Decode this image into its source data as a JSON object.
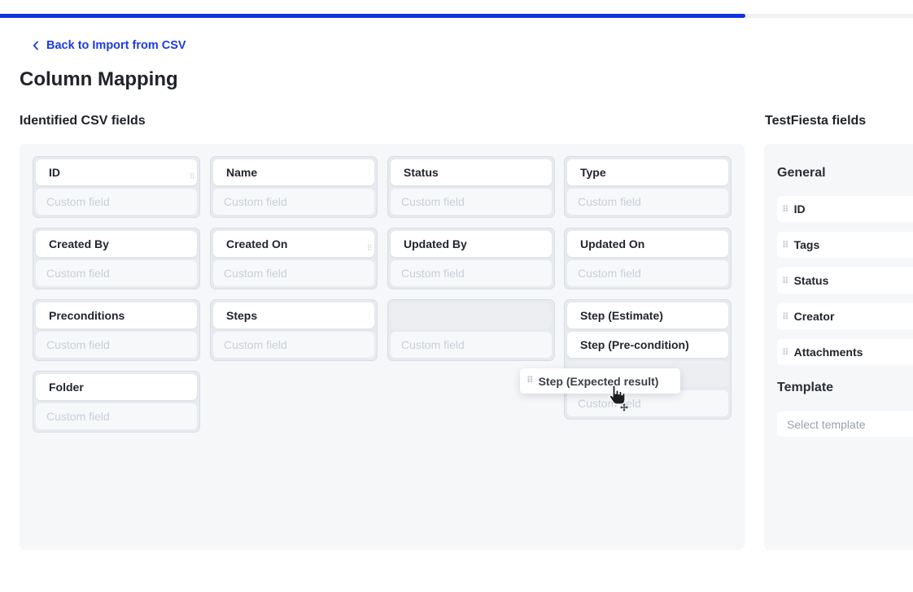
{
  "progress": {
    "percent": 81.6,
    "color": "#1233e0"
  },
  "back_link": {
    "label": "Back to Import from CSV"
  },
  "page_title": "Column Mapping",
  "csv_section": {
    "title": "Identified CSV fields",
    "placeholder": "Custom field",
    "cards": [
      {
        "name": "ID"
      },
      {
        "name": "Name"
      },
      {
        "name": "Status"
      },
      {
        "name": "Type"
      },
      {
        "name": "Created By"
      },
      {
        "name": "Created On"
      },
      {
        "name": "Updated By"
      },
      {
        "name": "Updated On"
      },
      {
        "name": "Preconditions"
      },
      {
        "name": "Steps"
      },
      {
        "name": ""
      },
      {
        "name": "Step (Estimate)",
        "name2": "Step (Pre-condition)"
      },
      {
        "name": "Folder"
      }
    ]
  },
  "drag_ghost": {
    "label": "Step (Expected result)"
  },
  "testfiesta_section": {
    "title": "TestFiesta fields",
    "general_title": "General",
    "fields": [
      "ID",
      "Tags",
      "Status",
      "Creator",
      "Attachments"
    ],
    "template_title": "Template",
    "template_placeholder": "Select template"
  },
  "icons": {
    "back": "chevron-left-icon",
    "drag": "drag-handle-icon",
    "cursor": "hand-pointer-icon"
  }
}
